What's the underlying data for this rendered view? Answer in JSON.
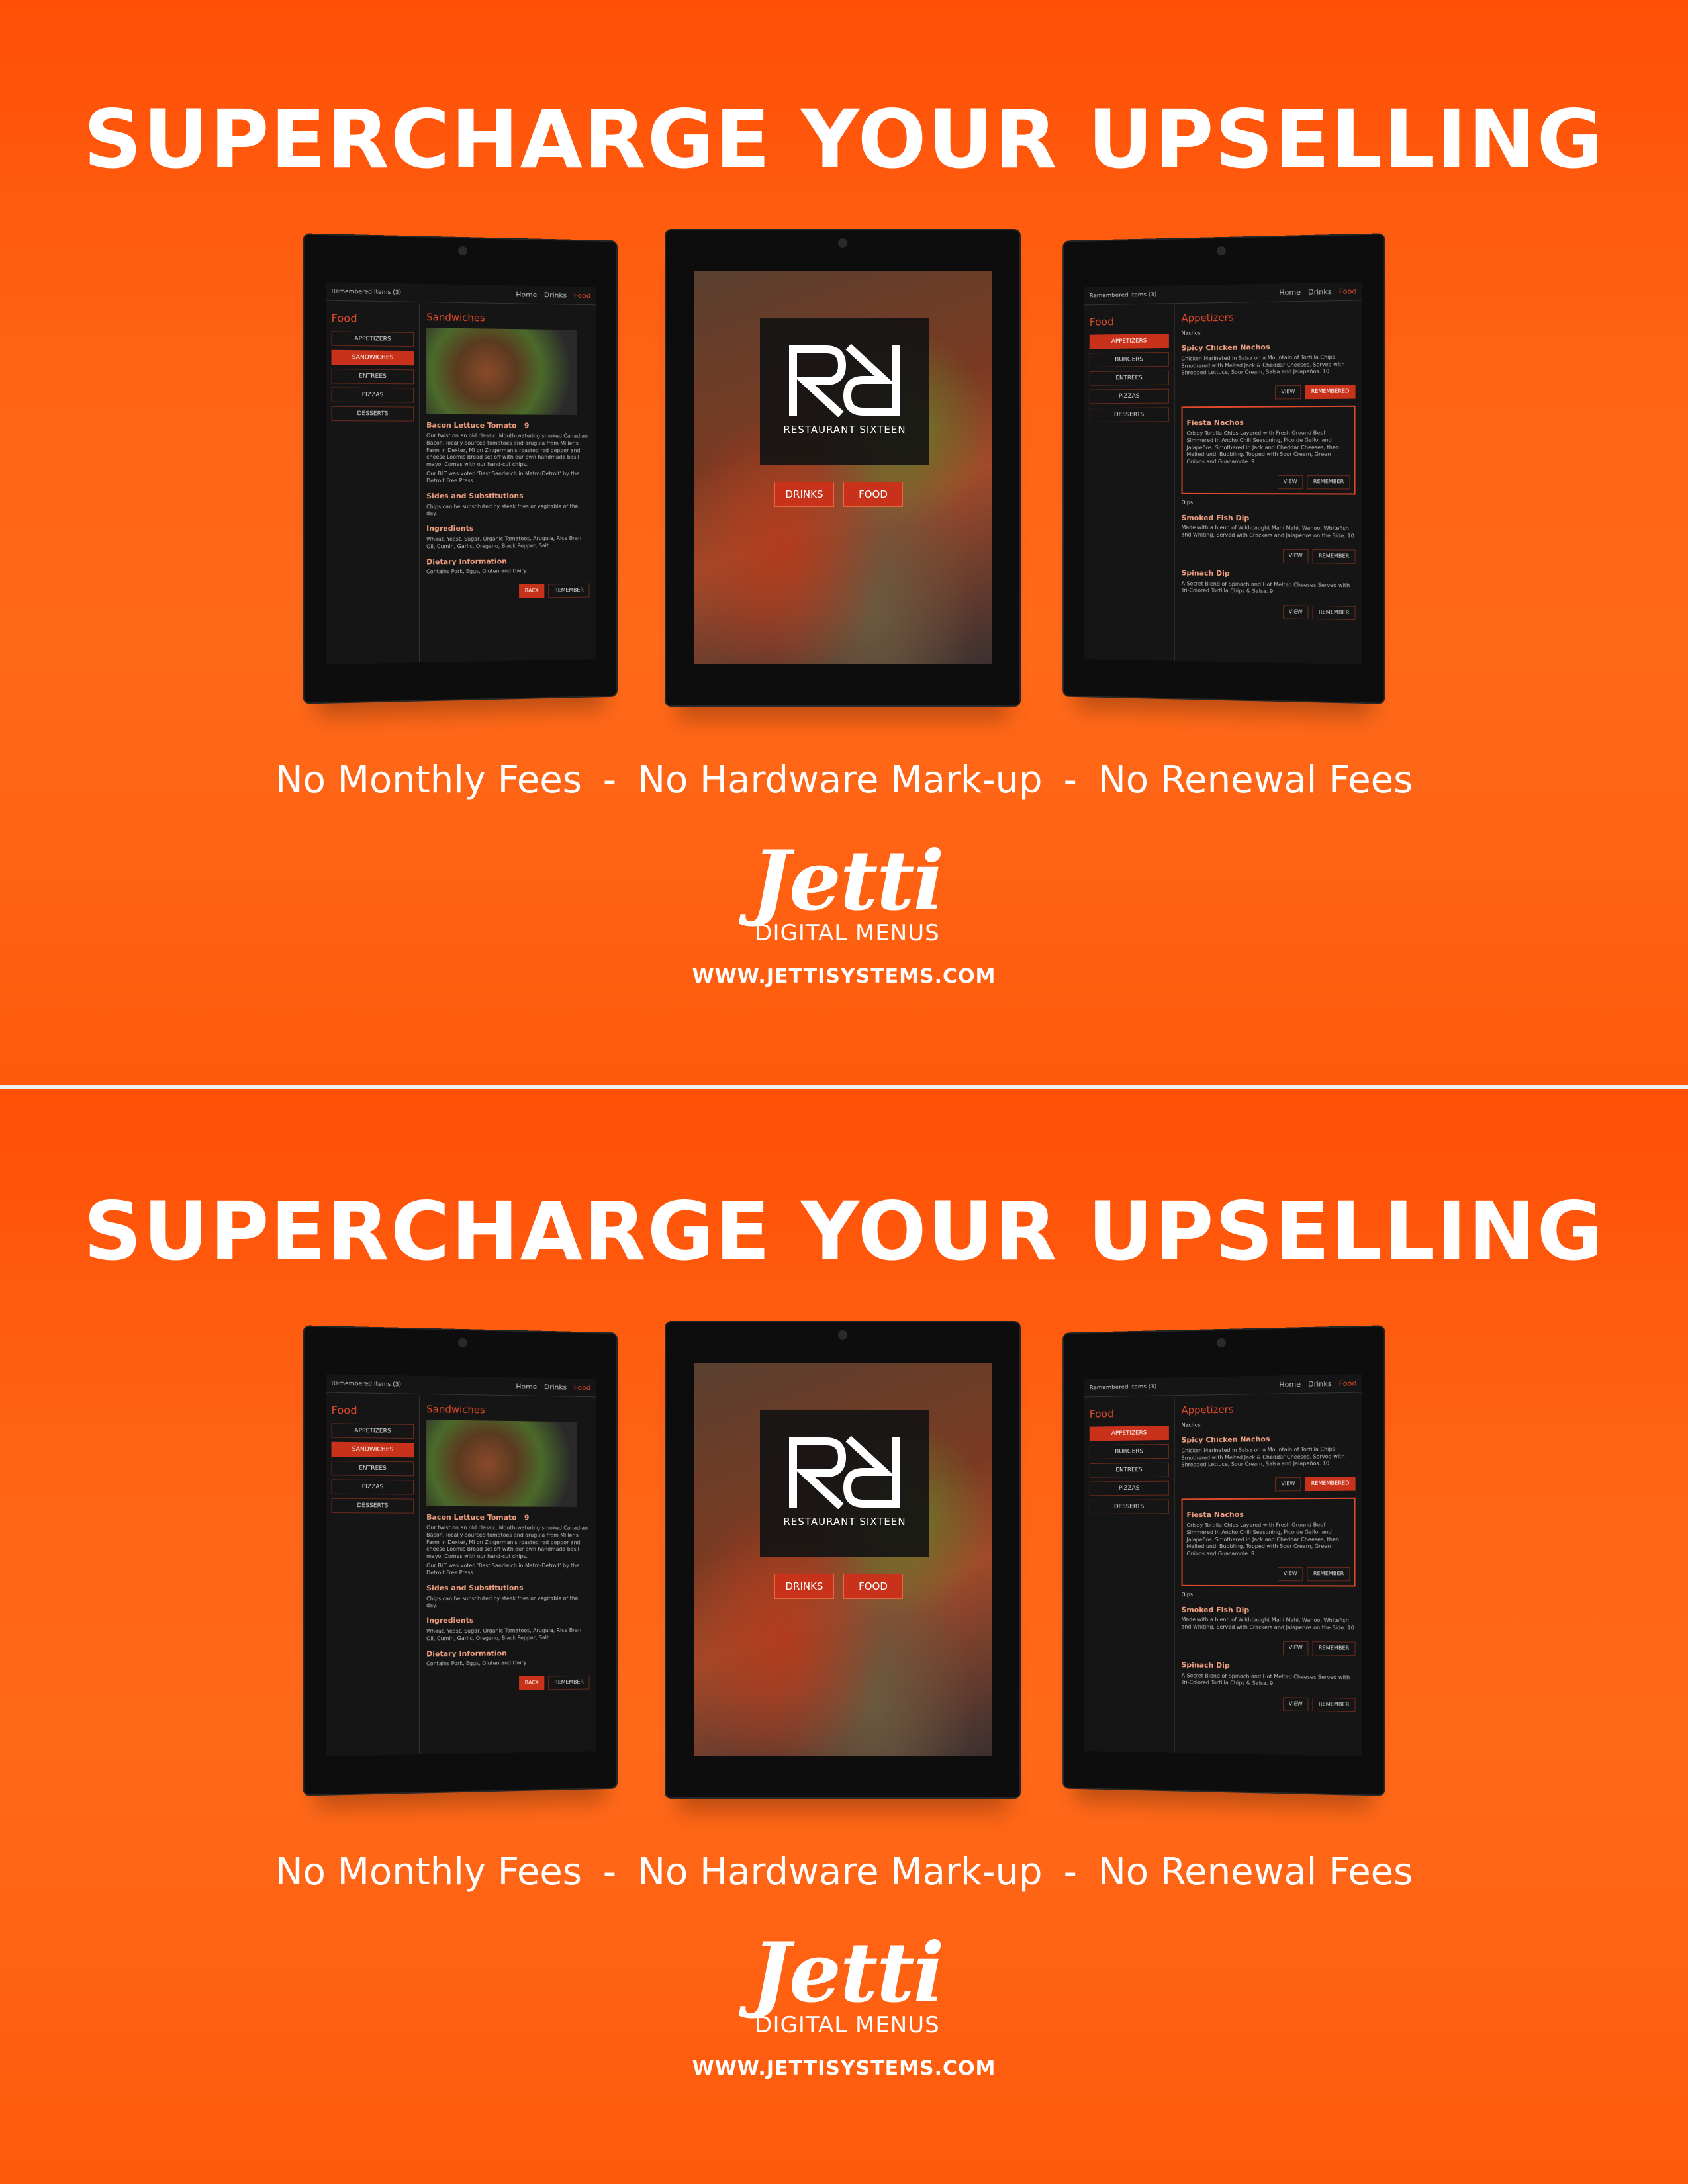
{
  "headline": "SUPERCHARGE YOUR UPSELLING",
  "features": [
    "No Monthly Fees",
    "No Hardware Mark-up",
    "No Renewal Fees"
  ],
  "separator_char": "-",
  "brand": {
    "name": "Jetti",
    "tagline": "DIGITAL MENUS",
    "url": "WWW.JETTISYSTEMS.COM"
  },
  "left_tablet": {
    "remembered": "Remembered Items (3)",
    "nav": [
      "Home",
      "Drinks",
      "Food"
    ],
    "section": "Food",
    "categories": [
      "Appetizers",
      "Sandwiches",
      "Entrees",
      "Pizzas",
      "Desserts"
    ],
    "category_title": "Sandwiches",
    "item_title": "Bacon Lettuce Tomato",
    "item_price": "9",
    "item_desc": "Our twist on an old classic. Mouth-watering smoked Canadian Bacon, locally-sourced tomatoes and arugula from Miller's Farm in Dexter, MI on Zingerman's roasted red pepper and cheese Loomis Bread set off with our own handmade basil mayo. Comes with our hand-cut chips.",
    "item_note": "Our BLT was voted 'Best Sandwich in Metro-Detroit' by the Detroit Free Press",
    "sides_title": "Sides and Substitutions",
    "sides_text": "Chips can be substituted by steak fries or vegitable of the day.",
    "ingredients_title": "Ingredients",
    "ingredients_text": "Wheat, Yeast, Sugar, Organic Tomatoes, Arugula, Rice Bran Oil, Cumin, Garlic, Oregano, Black Pepper, Salt",
    "dietary_title": "Dietary Information",
    "dietary_text": "Contains Pork, Eggs, Gluten and Dairy",
    "back": "Back",
    "remember": "Remember"
  },
  "center_tablet": {
    "restaurant": "RESTAURANT SIXTEEN",
    "drinks": "DRINKS",
    "food": "FOOD"
  },
  "right_tablet": {
    "remembered": "Remembered Items (3)",
    "nav": [
      "Home",
      "Drinks",
      "Food"
    ],
    "section": "Food",
    "categories": [
      "Appetizers",
      "Burgers",
      "Entrees",
      "Pizzas",
      "Desserts"
    ],
    "category_title": "Appetizers",
    "group1": "Nachos",
    "item1_title": "Spicy Chicken Nachos",
    "item1_desc": "Chicken Marinated in Salsa on a Mountain of Tortilla Chips Smothered with Melted Jack & Cheddar Cheeses. Served with Shredded Lettuce, Sour Cream, Salsa and Jalapeños.",
    "item1_price": "10",
    "item2_title": "Fiesta Nachos",
    "item2_desc": "Crispy Tortilla Chips Layered with Fresh Ground Beef Simmered in Ancho Chili Seasoning, Pico de Gallo, and Jalapeños. Smothered in Jack and Cheddar Cheeses, then Melted until Bubbling. Topped with Sour Cream, Green Onions and Guacamole.",
    "item2_price": "9",
    "group2": "Dips",
    "item3_title": "Smoked Fish Dip",
    "item3_desc": "Made with a blend of Wild-caught Mahi Mahi, Wahoo, Whitefish and Whiting. Served with Crackers and Jalapenos on the Side.",
    "item3_price": "10",
    "item4_title": "Spinach Dip",
    "item4_desc": "A Secret Blend of Spinach and Hot Melted Cheeses Served with Tri-Colored Tortilla Chips & Salsa.",
    "item4_price": "9",
    "view": "View",
    "remember": "Remember",
    "remembered_btn": "Remembered"
  }
}
